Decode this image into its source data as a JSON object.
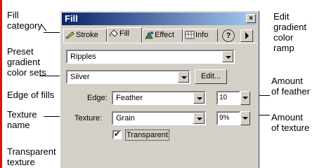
{
  "callouts": {
    "fill_category": "Fill\ncategory",
    "preset_gradient": "Preset\ngradient\ncolor sets",
    "edge_of_fills": "Edge of fills",
    "texture_name": "Texture\nname",
    "transparent_texture": "Transparent\ntexture",
    "edit_gradient": "Edit\ngradient\ncolor\nramp",
    "amount_feather": "Amount\nof feather",
    "amount_texture": "Amount\nof texture"
  },
  "panel": {
    "title": "Fill",
    "tabs": [
      {
        "label": "Stroke",
        "icon": "pencil-icon"
      },
      {
        "label": "Fill",
        "icon": "paint-bucket-icon"
      },
      {
        "label": "Effect",
        "icon": "effect-icon"
      },
      {
        "label": "Info",
        "icon": "info-grid-icon"
      }
    ],
    "help_label": "?",
    "fill_type": "Ripples",
    "gradient_preset": "Silver",
    "edit_button": "Edit...",
    "edge_label": "Edge:",
    "edge_value": "Feather",
    "feather_amount": "10",
    "texture_label": "Texture:",
    "texture_value": "Grain",
    "texture_amount": "9%",
    "transparent_label": "Transparent",
    "transparent_checked": true,
    "checkmark": "✔"
  },
  "colors": {
    "title_start": "#0a246a",
    "title_end": "#a6caf0",
    "panel_bg": "#d4d0c8",
    "left_bar": "#e01010"
  }
}
